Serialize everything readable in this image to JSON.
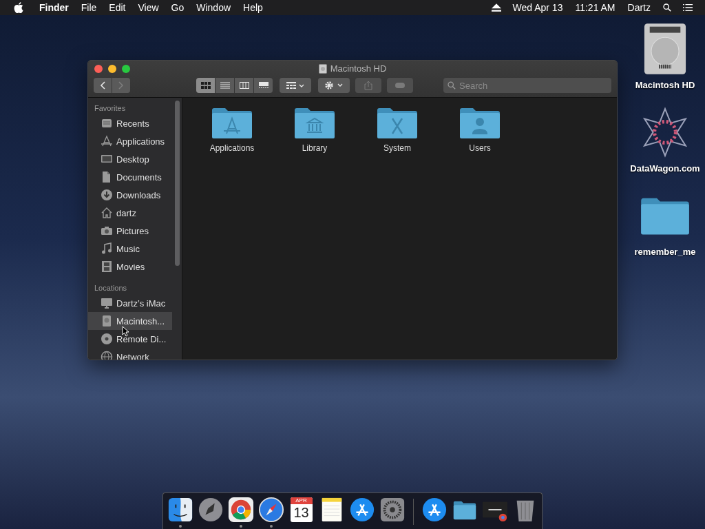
{
  "menu_bar": {
    "app_name": "Finder",
    "menus": [
      "File",
      "Edit",
      "View",
      "Go",
      "Window",
      "Help"
    ],
    "date": "Wed Apr 13",
    "time": "11:21 AM",
    "user": "Dartz"
  },
  "window": {
    "title": "Macintosh HD",
    "nav": [
      {
        "kind": "back",
        "disabled": false
      },
      {
        "kind": "forward",
        "disabled": true
      }
    ],
    "view_buttons": [
      {
        "kind": "icon",
        "selected": true
      },
      {
        "kind": "list",
        "selected": false
      },
      {
        "kind": "columns",
        "selected": false
      },
      {
        "kind": "gallery",
        "selected": false
      }
    ],
    "search": {
      "placeholder": "Search"
    },
    "sidebar": [
      {
        "heading": "Favorites",
        "items": [
          {
            "label": "Recents",
            "kind": "recents",
            "selected": false
          },
          {
            "label": "Applications",
            "kind": "applications",
            "selected": false
          },
          {
            "label": "Desktop",
            "kind": "desktop",
            "selected": false
          },
          {
            "label": "Documents",
            "kind": "documents",
            "selected": false
          },
          {
            "label": "Downloads",
            "kind": "downloads",
            "selected": false
          },
          {
            "label": "dartz",
            "kind": "home",
            "selected": false
          },
          {
            "label": "Pictures",
            "kind": "pictures",
            "selected": false
          },
          {
            "label": "Music",
            "kind": "music",
            "selected": false
          },
          {
            "label": "Movies",
            "kind": "movies",
            "selected": false
          }
        ]
      },
      {
        "heading": "Locations",
        "items": [
          {
            "label": "Dartz’s iMac",
            "kind": "computer",
            "selected": false
          },
          {
            "label": "Macintosh...",
            "kind": "disk",
            "selected": true
          },
          {
            "label": "Remote Di...",
            "kind": "disc",
            "selected": false
          },
          {
            "label": "Network",
            "kind": "network",
            "selected": false
          }
        ]
      }
    ],
    "items": [
      {
        "label": "Applications",
        "kind": "applications"
      },
      {
        "label": "Library",
        "kind": "library"
      },
      {
        "label": "System",
        "kind": "system"
      },
      {
        "label": "Users",
        "kind": "users"
      }
    ]
  },
  "desktop_icons": [
    {
      "label": "Macintosh HD",
      "kind": "disk"
    },
    {
      "label": "DataWagon.com",
      "kind": "star"
    },
    {
      "label": "remember_me",
      "kind": "folder"
    }
  ],
  "dock": {
    "apps": [
      {
        "kind": "finder",
        "running": true
      },
      {
        "kind": "launchpad",
        "running": false
      },
      {
        "kind": "chrome",
        "running": true
      },
      {
        "kind": "safari",
        "running": true
      },
      {
        "kind": "calendar",
        "running": false,
        "month": "APR",
        "day": "13"
      },
      {
        "kind": "notes",
        "running": false
      },
      {
        "kind": "app-store",
        "running": false
      },
      {
        "kind": "settings",
        "running": false
      }
    ],
    "others": [
      {
        "kind": "app-store",
        "running": false
      },
      {
        "kind": "folder",
        "running": false
      },
      {
        "kind": "window",
        "running": false
      },
      {
        "kind": "trash",
        "running": false
      }
    ]
  }
}
